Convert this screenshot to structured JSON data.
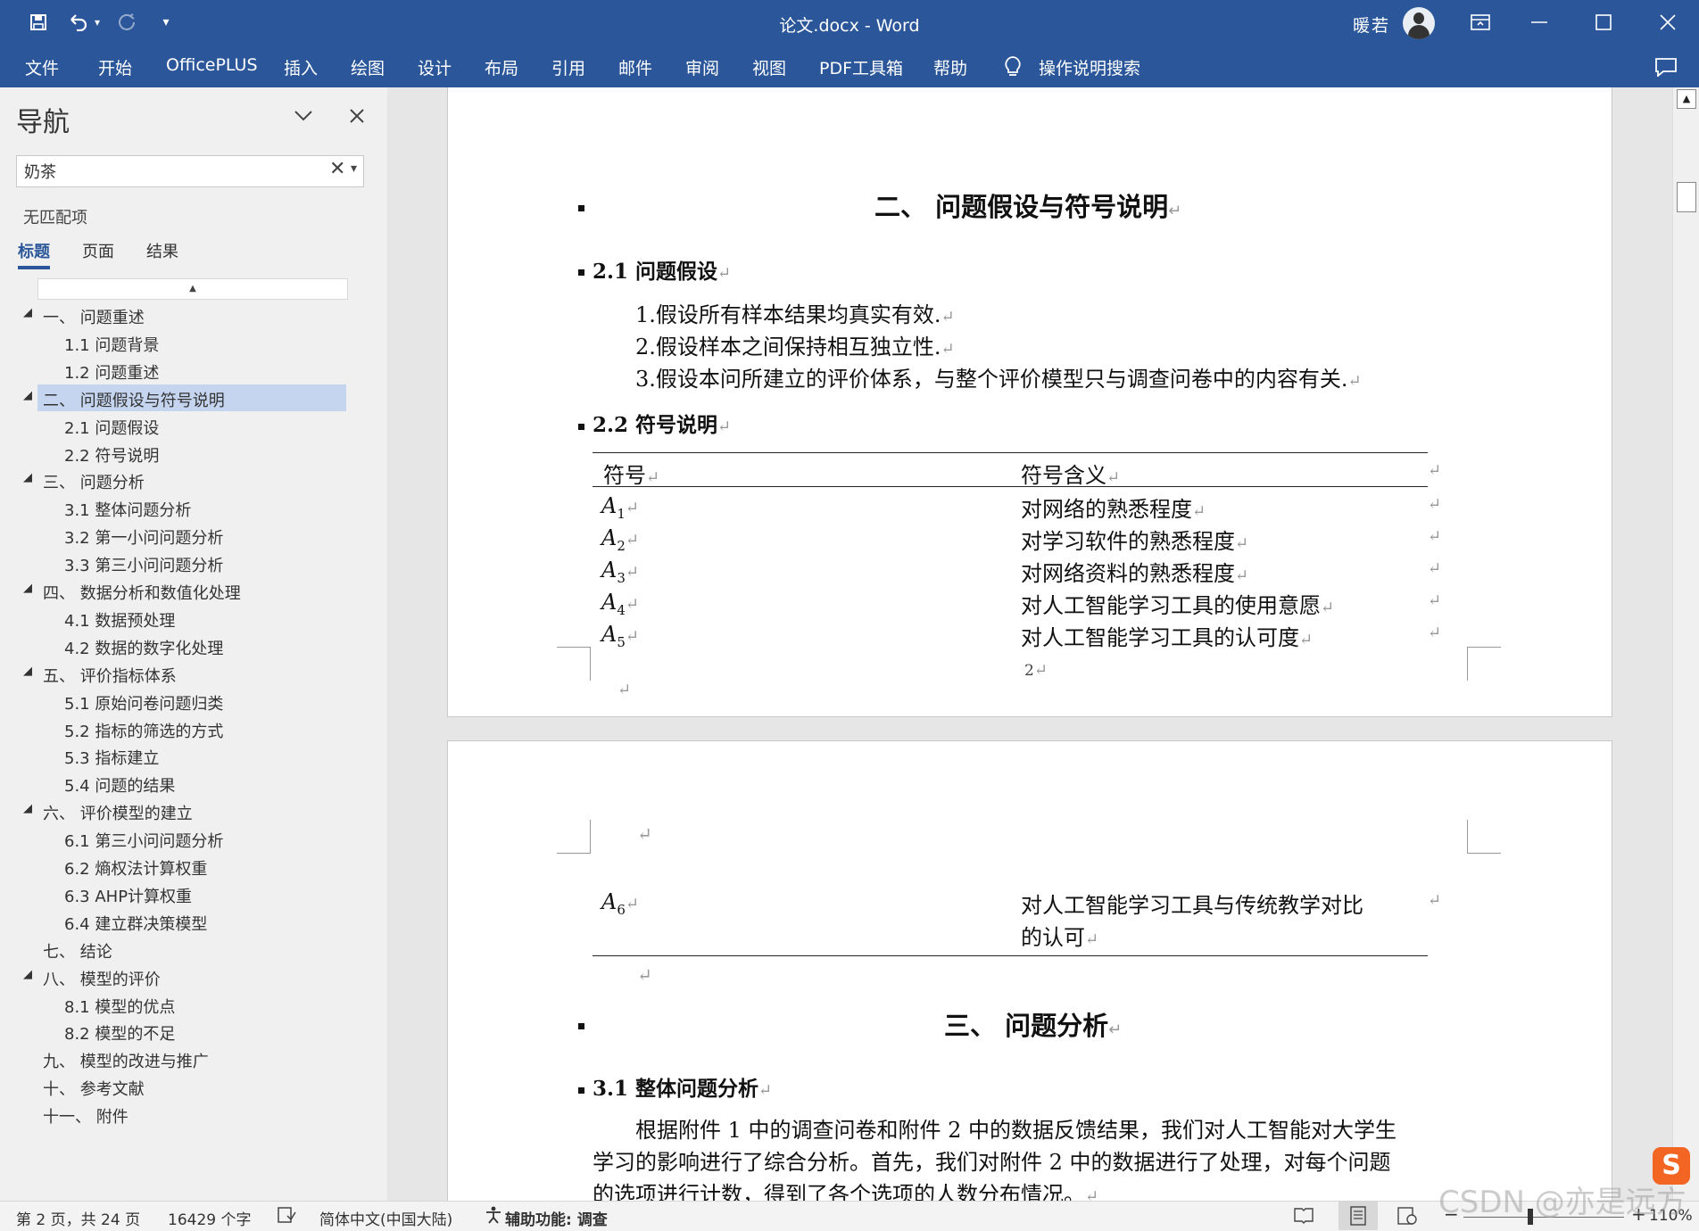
{
  "window": {
    "title": "论文.docx  -  Word",
    "user": "暖若"
  },
  "ribbon": {
    "tabs": [
      "文件",
      "开始",
      "OfficePLUS",
      "插入",
      "绘图",
      "设计",
      "布局",
      "引用",
      "邮件",
      "审阅",
      "视图",
      "PDF工具箱",
      "帮助"
    ],
    "search_label": "操作说明搜索"
  },
  "nav": {
    "title": "导航",
    "search_value": "奶茶",
    "no_match": "无匹配项",
    "tabs": [
      "标题",
      "页面",
      "结果"
    ],
    "outline": [
      {
        "level": 1,
        "expand": true,
        "text": "一、 问题重述"
      },
      {
        "level": 2,
        "text": "1.1 问题背景"
      },
      {
        "level": 2,
        "text": "1.2 问题重述"
      },
      {
        "level": 1,
        "expand": true,
        "text": "二、 问题假设与符号说明",
        "selected": true
      },
      {
        "level": 2,
        "text": "2.1 问题假设"
      },
      {
        "level": 2,
        "text": "2.2 符号说明"
      },
      {
        "level": 1,
        "expand": true,
        "text": "三、 问题分析"
      },
      {
        "level": 2,
        "text": "3.1 整体问题分析"
      },
      {
        "level": 2,
        "text": "3.2 第一小问问题分析"
      },
      {
        "level": 2,
        "text": "3.3 第三小问问题分析"
      },
      {
        "level": 1,
        "expand": true,
        "text": "四、 数据分析和数值化处理"
      },
      {
        "level": 2,
        "text": "4.1 数据预处理"
      },
      {
        "level": 2,
        "text": "4.2 数据的数字化处理"
      },
      {
        "level": 1,
        "expand": true,
        "text": "五、 评价指标体系"
      },
      {
        "level": 2,
        "text": "5.1 原始问卷问题归类"
      },
      {
        "level": 2,
        "text": "5.2 指标的筛选的方式"
      },
      {
        "level": 2,
        "text": "5.3 指标建立"
      },
      {
        "level": 2,
        "text": "5.4 问题的结果"
      },
      {
        "level": 1,
        "expand": true,
        "text": "六、 评价模型的建立"
      },
      {
        "level": 2,
        "text": "6.1 第三小问问题分析"
      },
      {
        "level": 2,
        "text": "6.2 熵权法计算权重"
      },
      {
        "level": 2,
        "text": "6.3 AHP计算权重"
      },
      {
        "level": 2,
        "text": "6.4 建立群决策模型"
      },
      {
        "level": 1,
        "expand": false,
        "text": "七、 结论"
      },
      {
        "level": 1,
        "expand": true,
        "text": "八、 模型的评价"
      },
      {
        "level": 2,
        "text": "8.1 模型的优点"
      },
      {
        "level": 2,
        "text": "8.2 模型的不足"
      },
      {
        "level": 1,
        "expand": false,
        "text": "九、 模型的改进与推广"
      },
      {
        "level": 1,
        "expand": false,
        "text": "十、 参考文献"
      },
      {
        "level": 1,
        "expand": false,
        "text": "十一、 附件"
      }
    ]
  },
  "doc": {
    "sec2_heading": "二、  问题假设与符号说明",
    "sec21_heading": "2.1 问题假设",
    "assumptions": [
      "1.假设所有样本结果均真实有效.",
      "2.假设样本之间保持相互独立性.",
      "3.假设本问所建立的评价体系，与整个评价模型只与调查问卷中的内容有关."
    ],
    "sec22_heading": "2.2 符号说明",
    "table_headers": [
      "符号",
      "符号含义"
    ],
    "symbols": [
      {
        "sym": "A",
        "sub": "1",
        "meaning": "对网络的熟悉程度"
      },
      {
        "sym": "A",
        "sub": "2",
        "meaning": "对学习软件的熟悉程度"
      },
      {
        "sym": "A",
        "sub": "3",
        "meaning": "对网络资料的熟悉程度"
      },
      {
        "sym": "A",
        "sub": "4",
        "meaning": "对人工智能学习工具的使用意愿"
      },
      {
        "sym": "A",
        "sub": "5",
        "meaning": "对人工智能学习工具的认可度"
      }
    ],
    "page_number": "2",
    "symbol6": {
      "sym": "A",
      "sub": "6",
      "meaning_line1": "对人工智能学习工具与传统教学对比",
      "meaning_line2": "的认可"
    },
    "sec3_heading": "三、  问题分析",
    "sec31_heading": "3.1 整体问题分析",
    "para_line1": "根据附件 1 中的调查问卷和附件 2 中的数据反馈结果，我们对人工智能对大学生",
    "para_line2": "学习的影响进行了综合分析。首先，我们对附件 2 中的数据进行了处理，对每个问题",
    "para_line3": "的选项进行计数，得到了各个选项的人数分布情况。"
  },
  "status": {
    "page": "第 2 页，共 24 页",
    "words": "16429 个字",
    "language": "简体中文(中国大陆)",
    "accessibility": "辅助功能: 调查",
    "zoom": "110%"
  },
  "watermark": "CSDN @亦是远方",
  "colors": {
    "accent": "#2b579a",
    "selection": "#c5d4ef"
  }
}
